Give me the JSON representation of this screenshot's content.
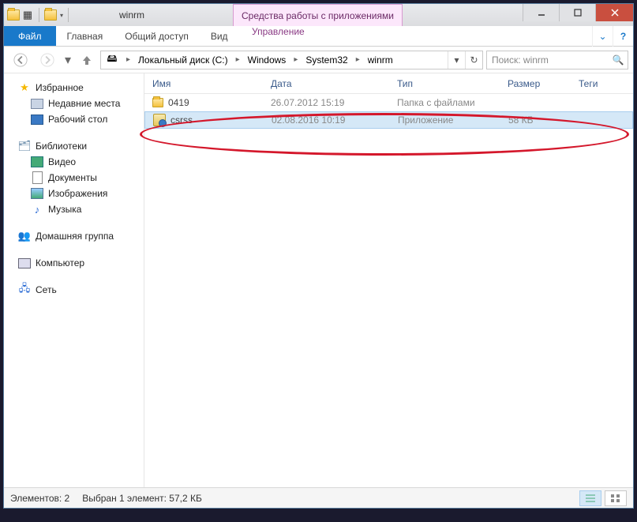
{
  "title": "winrm",
  "context_tab": "Средства работы с приложениями",
  "ribbon": {
    "file": "Файл",
    "tabs": [
      "Главная",
      "Общий доступ",
      "Вид"
    ],
    "ctx_tab": "Управление"
  },
  "breadcrumb": {
    "segs": [
      "Локальный диск (C:)",
      "Windows",
      "System32",
      "winrm"
    ]
  },
  "search": {
    "placeholder": "Поиск: winrm"
  },
  "sidebar": {
    "fav": {
      "head": "Избранное",
      "items": [
        "Недавние места",
        "Рабочий стол"
      ]
    },
    "lib": {
      "head": "Библиотеки",
      "items": [
        "Видео",
        "Документы",
        "Изображения",
        "Музыка"
      ]
    },
    "home": "Домашняя группа",
    "comp": "Компьютер",
    "net": "Сеть"
  },
  "columns": {
    "name": "Имя",
    "date": "Дата",
    "type": "Тип",
    "size": "Размер",
    "tags": "Теги"
  },
  "rows": [
    {
      "name": "0419",
      "date": "26.07.2012 15:19",
      "type": "Папка с файлами",
      "size": ""
    },
    {
      "name": "csrss",
      "date": "02.08.2016 10:19",
      "type": "Приложение",
      "size": "58 КБ"
    }
  ],
  "status": {
    "count": "Элементов: 2",
    "sel": "Выбран 1 элемент: 57,2 КБ"
  }
}
